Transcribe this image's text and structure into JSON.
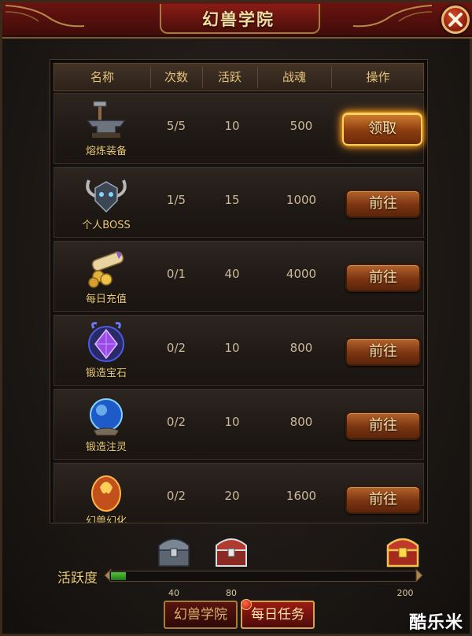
{
  "window": {
    "title": "幻兽学院"
  },
  "table": {
    "headers": [
      "名称",
      "次数",
      "活跃",
      "战魂",
      "操作"
    ],
    "rows": [
      {
        "name": "熔炼装备",
        "icon": "anvil-icon",
        "times": "5/5",
        "activity": "10",
        "soul": "500",
        "action": "领取"
      },
      {
        "name": "个人BOSS",
        "icon": "boss-skull-icon",
        "times": "1/5",
        "activity": "15",
        "soul": "1000",
        "action": "前往"
      },
      {
        "name": "每日充值",
        "icon": "scroll-coins-icon",
        "times": "0/1",
        "activity": "40",
        "soul": "4000",
        "action": "前往"
      },
      {
        "name": "锻造宝石",
        "icon": "purple-gem-icon",
        "times": "0/2",
        "activity": "10",
        "soul": "800",
        "action": "前往"
      },
      {
        "name": "锻造注灵",
        "icon": "blue-orb-icon",
        "times": "0/2",
        "activity": "10",
        "soul": "800",
        "action": "前往"
      },
      {
        "name": "幻兽幻化",
        "icon": "fire-egg-icon",
        "times": "0/2",
        "activity": "20",
        "soul": "1600",
        "action": "前往"
      }
    ]
  },
  "activity": {
    "label": "活跃度",
    "progress_fraction": 0.05,
    "milestones": [
      {
        "value": "40",
        "chest": "silver-chest-icon"
      },
      {
        "value": "80",
        "chest": "red-chest-icon"
      },
      {
        "value": "200",
        "chest": "gold-chest-icon"
      }
    ]
  },
  "tabs": [
    {
      "label": "幻兽学院",
      "active": false
    },
    {
      "label": "每日任务",
      "active": true
    }
  ],
  "watermark": "酷乐米",
  "colors": {
    "accent_gold": "#f0cf78",
    "button_brown": "#7a3412",
    "progress_green": "#53c43e",
    "title_red": "#6a1410"
  }
}
